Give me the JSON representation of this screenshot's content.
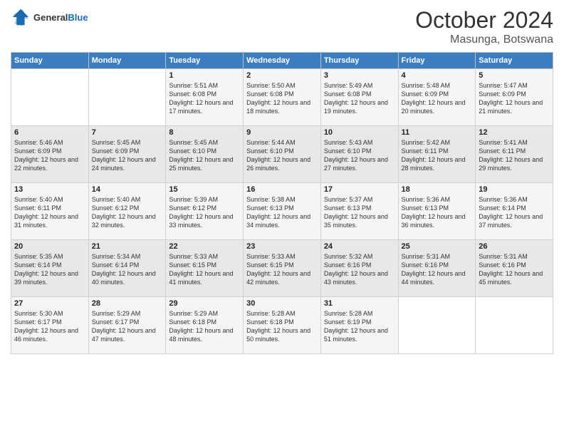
{
  "logo": {
    "general": "General",
    "blue": "Blue"
  },
  "header": {
    "month": "October 2024",
    "location": "Masunga, Botswana"
  },
  "weekdays": [
    "Sunday",
    "Monday",
    "Tuesday",
    "Wednesday",
    "Thursday",
    "Friday",
    "Saturday"
  ],
  "weeks": [
    [
      {
        "day": "",
        "sunrise": "",
        "sunset": "",
        "daylight": ""
      },
      {
        "day": "",
        "sunrise": "",
        "sunset": "",
        "daylight": ""
      },
      {
        "day": "1",
        "sunrise": "Sunrise: 5:51 AM",
        "sunset": "Sunset: 6:08 PM",
        "daylight": "Daylight: 12 hours and 17 minutes."
      },
      {
        "day": "2",
        "sunrise": "Sunrise: 5:50 AM",
        "sunset": "Sunset: 6:08 PM",
        "daylight": "Daylight: 12 hours and 18 minutes."
      },
      {
        "day": "3",
        "sunrise": "Sunrise: 5:49 AM",
        "sunset": "Sunset: 6:08 PM",
        "daylight": "Daylight: 12 hours and 19 minutes."
      },
      {
        "day": "4",
        "sunrise": "Sunrise: 5:48 AM",
        "sunset": "Sunset: 6:09 PM",
        "daylight": "Daylight: 12 hours and 20 minutes."
      },
      {
        "day": "5",
        "sunrise": "Sunrise: 5:47 AM",
        "sunset": "Sunset: 6:09 PM",
        "daylight": "Daylight: 12 hours and 21 minutes."
      }
    ],
    [
      {
        "day": "6",
        "sunrise": "Sunrise: 5:46 AM",
        "sunset": "Sunset: 6:09 PM",
        "daylight": "Daylight: 12 hours and 22 minutes."
      },
      {
        "day": "7",
        "sunrise": "Sunrise: 5:45 AM",
        "sunset": "Sunset: 6:09 PM",
        "daylight": "Daylight: 12 hours and 24 minutes."
      },
      {
        "day": "8",
        "sunrise": "Sunrise: 5:45 AM",
        "sunset": "Sunset: 6:10 PM",
        "daylight": "Daylight: 12 hours and 25 minutes."
      },
      {
        "day": "9",
        "sunrise": "Sunrise: 5:44 AM",
        "sunset": "Sunset: 6:10 PM",
        "daylight": "Daylight: 12 hours and 26 minutes."
      },
      {
        "day": "10",
        "sunrise": "Sunrise: 5:43 AM",
        "sunset": "Sunset: 6:10 PM",
        "daylight": "Daylight: 12 hours and 27 minutes."
      },
      {
        "day": "11",
        "sunrise": "Sunrise: 5:42 AM",
        "sunset": "Sunset: 6:11 PM",
        "daylight": "Daylight: 12 hours and 28 minutes."
      },
      {
        "day": "12",
        "sunrise": "Sunrise: 5:41 AM",
        "sunset": "Sunset: 6:11 PM",
        "daylight": "Daylight: 12 hours and 29 minutes."
      }
    ],
    [
      {
        "day": "13",
        "sunrise": "Sunrise: 5:40 AM",
        "sunset": "Sunset: 6:11 PM",
        "daylight": "Daylight: 12 hours and 31 minutes."
      },
      {
        "day": "14",
        "sunrise": "Sunrise: 5:40 AM",
        "sunset": "Sunset: 6:12 PM",
        "daylight": "Daylight: 12 hours and 32 minutes."
      },
      {
        "day": "15",
        "sunrise": "Sunrise: 5:39 AM",
        "sunset": "Sunset: 6:12 PM",
        "daylight": "Daylight: 12 hours and 33 minutes."
      },
      {
        "day": "16",
        "sunrise": "Sunrise: 5:38 AM",
        "sunset": "Sunset: 6:13 PM",
        "daylight": "Daylight: 12 hours and 34 minutes."
      },
      {
        "day": "17",
        "sunrise": "Sunrise: 5:37 AM",
        "sunset": "Sunset: 6:13 PM",
        "daylight": "Daylight: 12 hours and 35 minutes."
      },
      {
        "day": "18",
        "sunrise": "Sunrise: 5:36 AM",
        "sunset": "Sunset: 6:13 PM",
        "daylight": "Daylight: 12 hours and 36 minutes."
      },
      {
        "day": "19",
        "sunrise": "Sunrise: 5:36 AM",
        "sunset": "Sunset: 6:14 PM",
        "daylight": "Daylight: 12 hours and 37 minutes."
      }
    ],
    [
      {
        "day": "20",
        "sunrise": "Sunrise: 5:35 AM",
        "sunset": "Sunset: 6:14 PM",
        "daylight": "Daylight: 12 hours and 39 minutes."
      },
      {
        "day": "21",
        "sunrise": "Sunrise: 5:34 AM",
        "sunset": "Sunset: 6:14 PM",
        "daylight": "Daylight: 12 hours and 40 minutes."
      },
      {
        "day": "22",
        "sunrise": "Sunrise: 5:33 AM",
        "sunset": "Sunset: 6:15 PM",
        "daylight": "Daylight: 12 hours and 41 minutes."
      },
      {
        "day": "23",
        "sunrise": "Sunrise: 5:33 AM",
        "sunset": "Sunset: 6:15 PM",
        "daylight": "Daylight: 12 hours and 42 minutes."
      },
      {
        "day": "24",
        "sunrise": "Sunrise: 5:32 AM",
        "sunset": "Sunset: 6:16 PM",
        "daylight": "Daylight: 12 hours and 43 minutes."
      },
      {
        "day": "25",
        "sunrise": "Sunrise: 5:31 AM",
        "sunset": "Sunset: 6:16 PM",
        "daylight": "Daylight: 12 hours and 44 minutes."
      },
      {
        "day": "26",
        "sunrise": "Sunrise: 5:31 AM",
        "sunset": "Sunset: 6:16 PM",
        "daylight": "Daylight: 12 hours and 45 minutes."
      }
    ],
    [
      {
        "day": "27",
        "sunrise": "Sunrise: 5:30 AM",
        "sunset": "Sunset: 6:17 PM",
        "daylight": "Daylight: 12 hours and 46 minutes."
      },
      {
        "day": "28",
        "sunrise": "Sunrise: 5:29 AM",
        "sunset": "Sunset: 6:17 PM",
        "daylight": "Daylight: 12 hours and 47 minutes."
      },
      {
        "day": "29",
        "sunrise": "Sunrise: 5:29 AM",
        "sunset": "Sunset: 6:18 PM",
        "daylight": "Daylight: 12 hours and 48 minutes."
      },
      {
        "day": "30",
        "sunrise": "Sunrise: 5:28 AM",
        "sunset": "Sunset: 6:18 PM",
        "daylight": "Daylight: 12 hours and 50 minutes."
      },
      {
        "day": "31",
        "sunrise": "Sunrise: 5:28 AM",
        "sunset": "Sunset: 6:19 PM",
        "daylight": "Daylight: 12 hours and 51 minutes."
      },
      {
        "day": "",
        "sunrise": "",
        "sunset": "",
        "daylight": ""
      },
      {
        "day": "",
        "sunrise": "",
        "sunset": "",
        "daylight": ""
      }
    ]
  ]
}
